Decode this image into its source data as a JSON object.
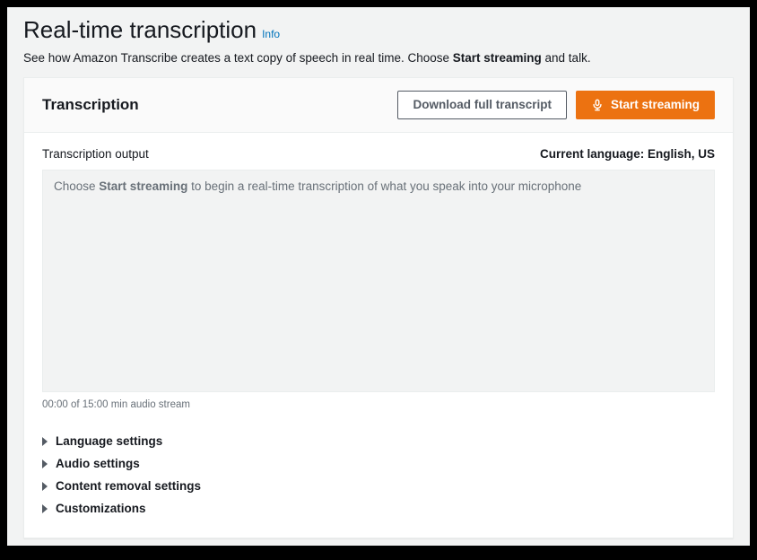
{
  "header": {
    "title": "Real-time transcription",
    "info": "Info",
    "desc_pre": "See how Amazon Transcribe creates a text copy of speech in real time. Choose ",
    "desc_strong": "Start streaming",
    "desc_post": " and talk."
  },
  "panel": {
    "title": "Transcription",
    "download_label": "Download full transcript",
    "start_label": "Start streaming"
  },
  "output": {
    "label": "Transcription output",
    "current_lang_label": "Current language: English, US",
    "placeholder_pre": "Choose ",
    "placeholder_strong": "Start streaming",
    "placeholder_post": " to begin a real-time transcription of what you speak into your microphone",
    "stream_time": "00:00 of 15:00 min audio stream"
  },
  "settings": [
    {
      "label": "Language settings"
    },
    {
      "label": "Audio settings"
    },
    {
      "label": "Content removal settings"
    },
    {
      "label": "Customizations"
    }
  ]
}
